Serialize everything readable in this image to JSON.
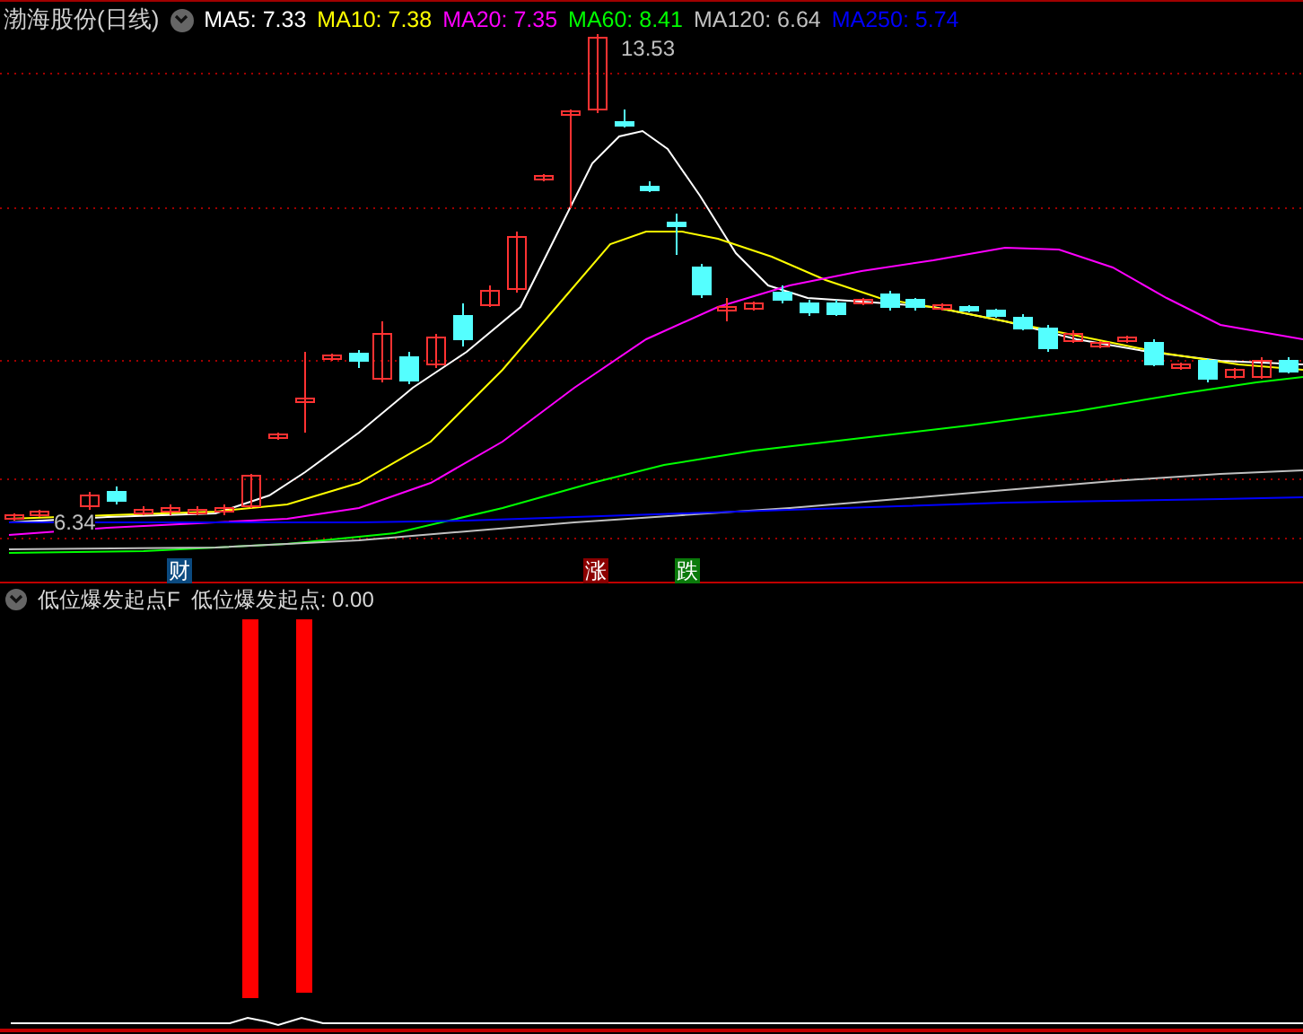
{
  "header": {
    "title": "渤海股份(日线)",
    "indicators": [
      {
        "label": "MA5: 7.33",
        "color": "#ffffff"
      },
      {
        "label": "MA10: 7.38",
        "color": "#ffff00"
      },
      {
        "label": "MA20: 7.35",
        "color": "#ff00ff"
      },
      {
        "label": "MA60: 8.41",
        "color": "#00ff00"
      },
      {
        "label": "MA120: 6.64",
        "color": "#c0c0c0"
      },
      {
        "label": "MA250: 5.74",
        "color": "#0000ff"
      }
    ]
  },
  "price_chart": {
    "high_label": "13.53",
    "low_label": "6.34",
    "markers": [
      {
        "text": "财",
        "color": "#0b4a80"
      },
      {
        "text": "涨",
        "color": "#8b0000"
      },
      {
        "text": "跌",
        "color": "#0a7a0a"
      }
    ]
  },
  "indicator_panel": {
    "name": "低位爆发起点F",
    "reading": "低位爆发起点: 0.00"
  }
}
